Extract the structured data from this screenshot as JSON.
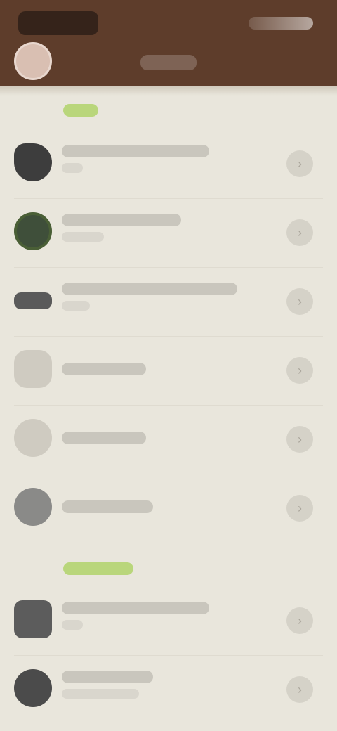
{
  "status_bar": {
    "left_text": "",
    "right_text": ""
  },
  "header": {
    "title": ""
  },
  "sections": [
    {
      "label": ""
    },
    {
      "label": ""
    }
  ],
  "rows": [
    {
      "title": "",
      "subtitle": "",
      "icon": "gear-icon"
    },
    {
      "title": "",
      "subtitle": "",
      "icon": "status-icon"
    },
    {
      "title": "",
      "subtitle": "",
      "icon": "display-icon"
    },
    {
      "title": "",
      "subtitle": "",
      "icon": "device-icon"
    },
    {
      "title": "",
      "subtitle": "",
      "icon": "circle-icon"
    },
    {
      "title": "",
      "subtitle": "",
      "icon": "circle-icon"
    },
    {
      "title": "",
      "subtitle": "",
      "icon": "folder-icon"
    },
    {
      "title": "",
      "subtitle": "",
      "icon": "circle-icon"
    }
  ],
  "colors": {
    "header_bg": "#5e3d2b",
    "page_bg": "#e9e6dc",
    "accent_green": "#6b8f2c"
  }
}
